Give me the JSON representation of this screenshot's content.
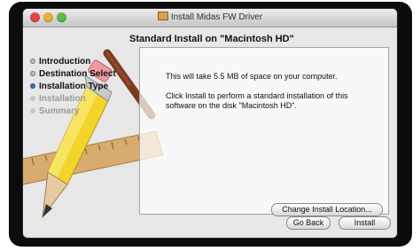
{
  "window": {
    "title": "Install Midas FW Driver",
    "heading": "Standard Install on \"Macintosh HD\""
  },
  "steps": [
    {
      "label": "Introduction",
      "state": "done"
    },
    {
      "label": "Destination Select",
      "state": "done"
    },
    {
      "label": "Installation Type",
      "state": "current"
    },
    {
      "label": "Installation",
      "state": "todo"
    },
    {
      "label": "Summary",
      "state": "todo"
    }
  ],
  "content": {
    "space_text": "This will take 5.5 MB of space on your computer.",
    "install_text": "Click Install to perform a standard installation of this software on the disk \"Macintosh HD\"."
  },
  "buttons": {
    "change_location": "Change Install Location...",
    "go_back": "Go Back",
    "install": "Install"
  },
  "icons": {
    "window_icon": "package-icon",
    "background_art": [
      "pencil-icon",
      "ruler-icon",
      "paintbrush-icon"
    ]
  },
  "colors": {
    "close": "#e2463f",
    "minimize": "#e8b03a",
    "zoom": "#5fba46",
    "current_step": "#3f6fc9"
  }
}
